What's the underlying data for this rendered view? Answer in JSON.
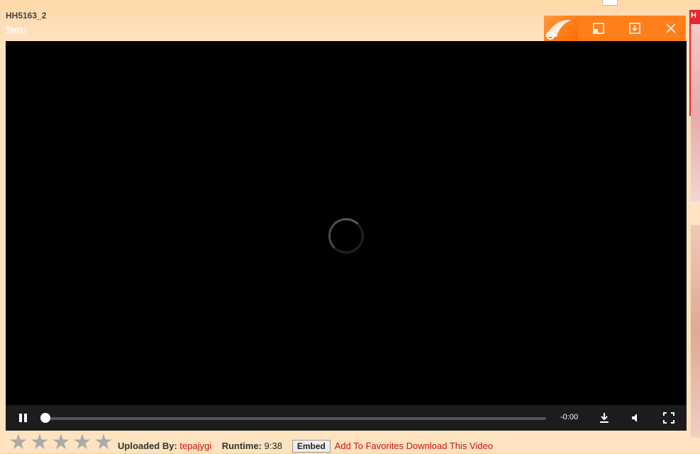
{
  "page": {
    "title": "HH5163_2",
    "tags_label": "Tags:"
  },
  "player": {
    "time_remaining": "-0:00",
    "progress": 0.0,
    "state": "loading"
  },
  "overlay": {
    "icons": [
      "logo-icon",
      "popout-icon",
      "download-icon",
      "close-icon"
    ]
  },
  "ad": {
    "label": "H"
  },
  "info": {
    "rating_stars": 5,
    "uploaded_by_label": "Uploaded By:",
    "uploader": "tepajygi",
    "runtime_label": "Runtime:",
    "runtime": "9:38",
    "embed_label": "Embed",
    "favorites_label": "Add To Favorites",
    "download_label": "Download This Video"
  },
  "colors": {
    "accent": "#ff7f1a",
    "link": "#cc1111",
    "background": "#fde3c0"
  }
}
